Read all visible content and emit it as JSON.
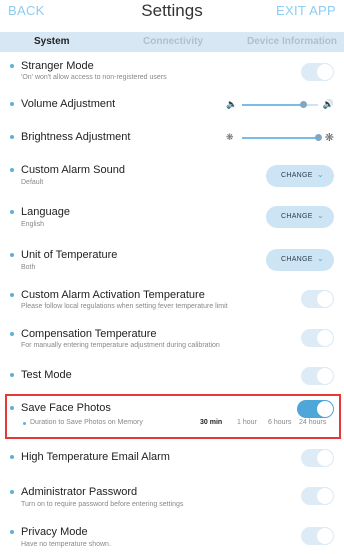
{
  "header": {
    "back": "BACK",
    "title": "Settings",
    "exit": "EXIT APP"
  },
  "tabs": [
    {
      "label": "System",
      "active": true
    },
    {
      "label": "Connectivity",
      "active": false
    },
    {
      "label": "Device Information",
      "active": false
    }
  ],
  "settings": {
    "stranger_mode": {
      "label": "Stranger Mode",
      "sub": "'On' won't allow access to non-registered users",
      "on": false
    },
    "volume": {
      "label": "Volume Adjustment",
      "level": 0.8
    },
    "brightness": {
      "label": "Brightness Adjustment",
      "level": 1.0
    },
    "custom_alarm": {
      "label": "Custom Alarm Sound",
      "sub": "Default",
      "button": "CHANGE"
    },
    "language": {
      "label": "Language",
      "sub": "English",
      "button": "CHANGE"
    },
    "unit_temp": {
      "label": "Unit of Temperature",
      "sub": "Both",
      "button": "CHANGE"
    },
    "custom_alarm_temp": {
      "label": "Custom Alarm Activation Temperature",
      "sub": "Please follow local regulations when setting fever temperature limit",
      "on": false
    },
    "compensation": {
      "label": "Compensation Temperature",
      "sub": "For manually entering temperature adjustment during calibration",
      "on": false
    },
    "test_mode": {
      "label": "Test Mode",
      "on": false
    },
    "save_face": {
      "label": "Save Face Photos",
      "on": true,
      "duration_label": "Duration to Save Photos on Memory",
      "options": [
        "30 min",
        "1 hour",
        "6 hours",
        "24 hours"
      ],
      "selected": "30 min"
    },
    "high_temp_email": {
      "label": "High Temperature Email Alarm",
      "on": false
    },
    "admin_password": {
      "label": "Administrator Password",
      "sub": "Turn on to require password before entering settings",
      "on": false
    },
    "privacy": {
      "label": "Privacy Mode",
      "sub": "Have no temperature shown.",
      "on": false
    }
  },
  "icons": {
    "volume_low": "speaker-low-icon",
    "volume_high": "speaker-high-icon",
    "brightness_low": "sun-low-icon",
    "brightness_high": "sun-high-icon",
    "chevron": "chevron-down-icon"
  },
  "colors": {
    "accent": "#4fa6d8",
    "tab_bg": "#d7e8f4",
    "highlight": "#e53935",
    "header_link": "#8ccdf0"
  }
}
